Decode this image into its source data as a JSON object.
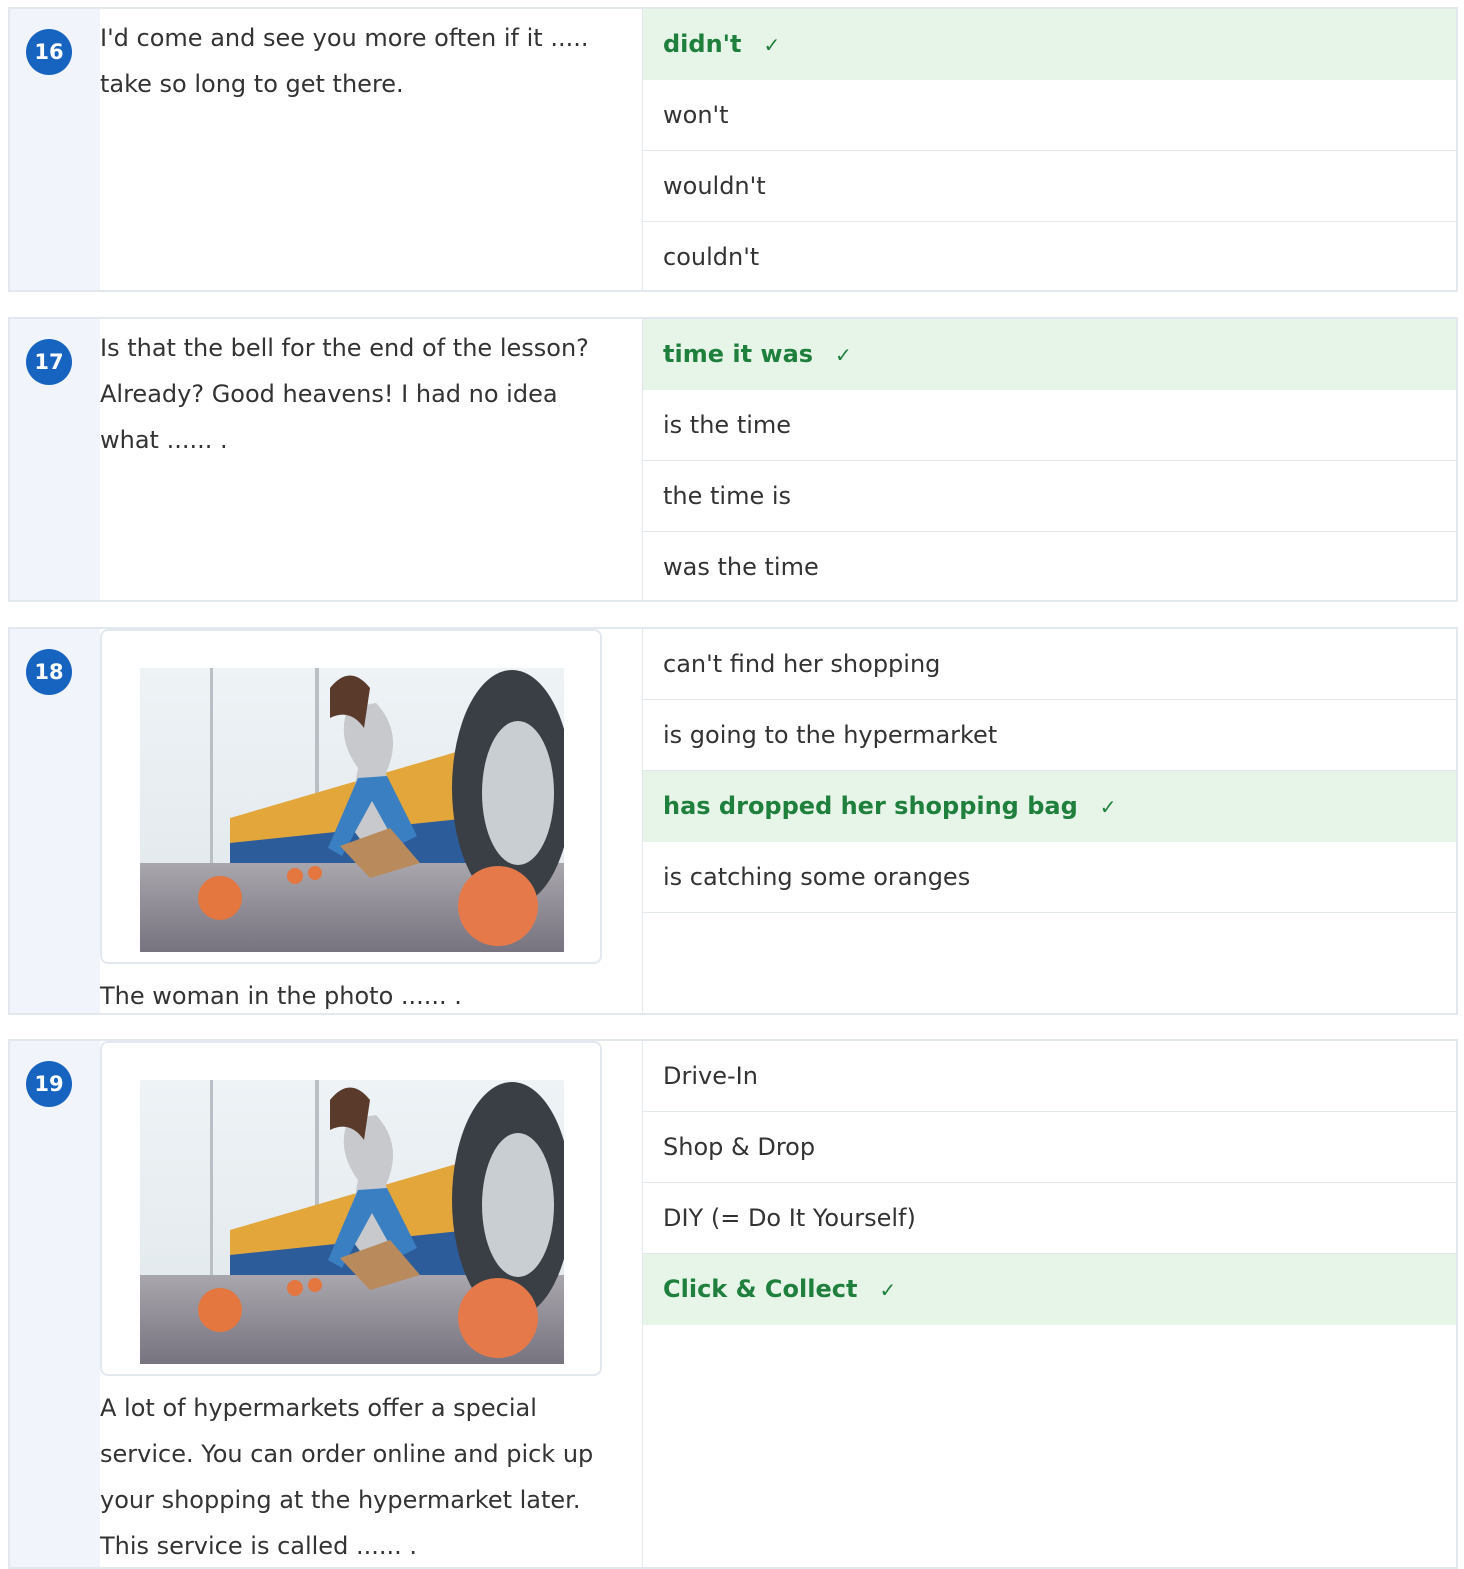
{
  "questions": [
    {
      "number": "16",
      "stem": [
        "I'd come and see you more often if it .....",
        "take so long to get there."
      ],
      "options": [
        {
          "label": "didn't",
          "correct": true
        },
        {
          "label": "won't",
          "correct": false
        },
        {
          "label": "wouldn't",
          "correct": false
        },
        {
          "label": "couldn't",
          "correct": false
        }
      ]
    },
    {
      "number": "17",
      "stem": [
        "Is that the bell for the end of the lesson?",
        "Already? Good heavens! I had no idea",
        "what ...... ."
      ],
      "options": [
        {
          "label": "time it was",
          "correct": true
        },
        {
          "label": "is the time",
          "correct": false
        },
        {
          "label": "the time is",
          "correct": false
        },
        {
          "label": "was the time",
          "correct": false
        }
      ]
    },
    {
      "number": "18",
      "stem": [
        "The woman in the photo ...... ."
      ],
      "options": [
        {
          "label": "can't find her shopping",
          "correct": false
        },
        {
          "label": "is going to the hypermarket",
          "correct": false
        },
        {
          "label": "has dropped her shopping bag",
          "correct": true
        },
        {
          "label": "is catching some oranges",
          "correct": false
        }
      ]
    },
    {
      "number": "19",
      "stem": [
        "A lot of hypermarkets offer a special",
        "service. You can order online and pick up",
        "your shopping at the hypermarket later.",
        "This service is called ...... ."
      ],
      "options": [
        {
          "label": "Drive-In",
          "correct": false
        },
        {
          "label": "Shop & Drop",
          "correct": false
        },
        {
          "label": "DIY (= Do It Yourself)",
          "correct": false
        },
        {
          "label": "Click & Collect",
          "correct": true
        }
      ]
    }
  ],
  "check_mark": "✓",
  "colors": {
    "badge": "#1764c0",
    "correct_bg": "#e7f5e8",
    "correct_text": "#1f7f3d",
    "border": "#e3e8ee"
  }
}
